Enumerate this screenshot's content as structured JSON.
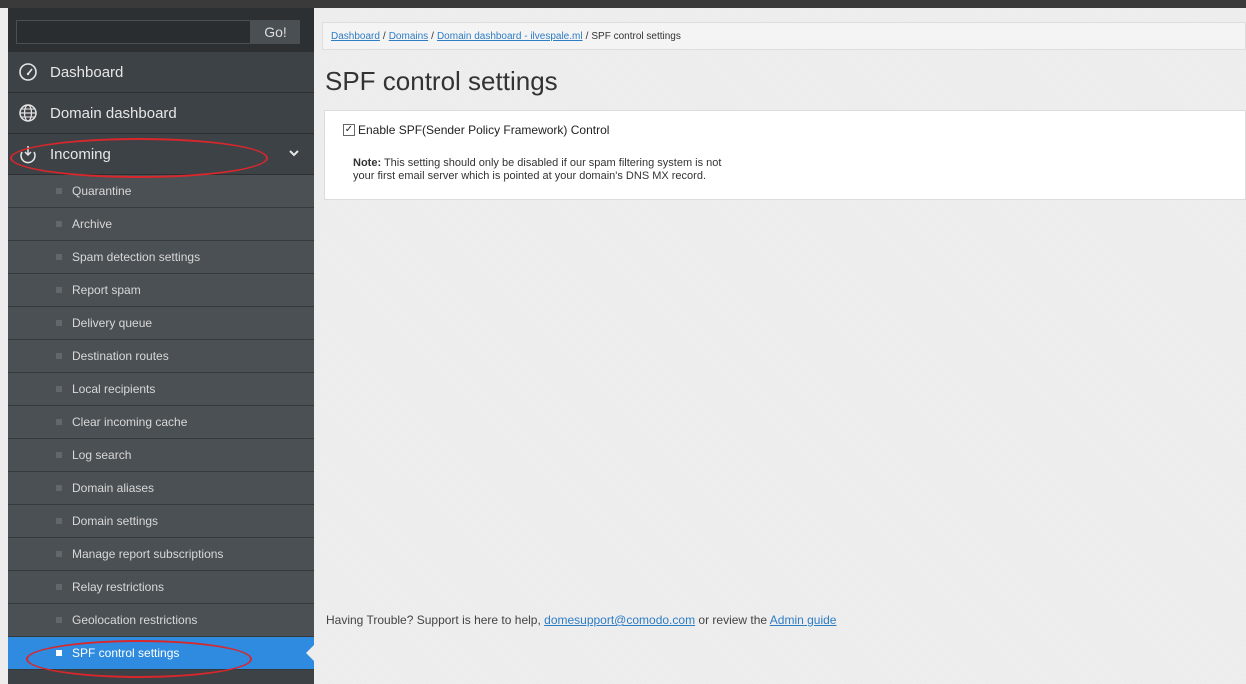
{
  "search": {
    "placeholder": "",
    "go_label": "Go!"
  },
  "sidebar": {
    "main_items": [
      {
        "label": "Dashboard",
        "icon": "dashboard-gauge-icon"
      },
      {
        "label": "Domain dashboard",
        "icon": "globe-icon"
      },
      {
        "label": "Incoming",
        "icon": "incoming-icon"
      }
    ],
    "incoming_sub_items": [
      "Quarantine",
      "Archive",
      "Spam detection settings",
      "Report spam",
      "Delivery queue",
      "Destination routes",
      "Local recipients",
      "Clear incoming cache",
      "Log search",
      "Domain aliases",
      "Domain settings",
      "Manage report subscriptions",
      "Relay restrictions",
      "Geolocation restrictions",
      "SPF control settings"
    ],
    "selected_item": "SPF control settings"
  },
  "breadcrumb": {
    "items": [
      "Dashboard",
      "Domains",
      "Domain dashboard - ilvespale.ml"
    ],
    "current": "SPF control settings",
    "separator": "/"
  },
  "page": {
    "title": "SPF control settings",
    "checkbox_label": "Enable SPF(Sender Policy Framework) Control",
    "checkbox_checked": true,
    "checkbox_mark": "✓",
    "note_label": "Note:",
    "note_text_line1": " This setting should only be disabled if our spam filtering system is not",
    "note_text_line2": "your first email server which is pointed at your domain's DNS MX record."
  },
  "footer": {
    "prefix": "Having Trouble? Support is here to help, ",
    "email": "domesupport@comodo.com",
    "middle": " or review the ",
    "guide_link": "Admin guide"
  },
  "colors": {
    "sidebar_bg": "#3d4246",
    "sub_item_bg": "#4b5054",
    "selected_bg": "#2e8be0",
    "link": "#2e7cc4",
    "annotation": "#d9272b"
  }
}
